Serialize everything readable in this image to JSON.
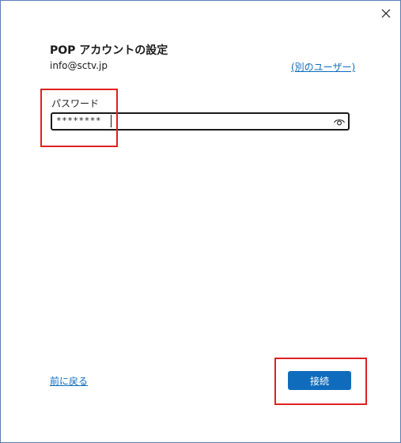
{
  "dialog": {
    "title": "POP アカウントの設定",
    "account_email": "info@sctv.jp",
    "other_user_link": "(別のユーザー)",
    "close_icon": "close-icon"
  },
  "password": {
    "label": "パスワード",
    "value": "********",
    "reveal_icon": "eye-icon"
  },
  "footer": {
    "back_link": "前に戻る",
    "connect_button": "接続"
  },
  "colors": {
    "accent": "#0f6cbd",
    "highlight": "#e02020",
    "border": "#5a7fb5"
  }
}
